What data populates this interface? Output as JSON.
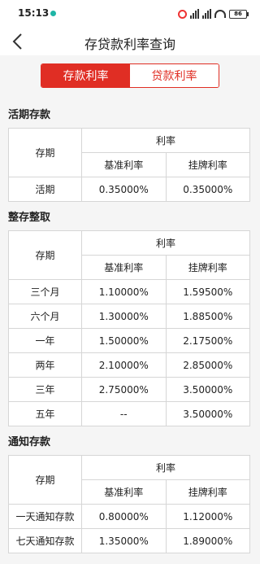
{
  "status_bar": {
    "time": "15:13",
    "battery": "86"
  },
  "header": {
    "title": "存贷款利率查询",
    "back_icon": "chevron-left-icon"
  },
  "tabs": [
    {
      "label": "存款利率",
      "active": true
    },
    {
      "label": "贷款利率",
      "active": false
    }
  ],
  "colors": {
    "accent": "#e02e24",
    "border": "#d6d6d6",
    "background": "#f5f5f5"
  },
  "sections": [
    {
      "title": "活期存款",
      "header": {
        "period": "存期",
        "rate": "利率",
        "base": "基准利率",
        "listed": "挂牌利率"
      },
      "rows": [
        {
          "period": "活期",
          "base": "0.35000%",
          "listed": "0.35000%"
        }
      ]
    },
    {
      "title": "整存整取",
      "header": {
        "period": "存期",
        "rate": "利率",
        "base": "基准利率",
        "listed": "挂牌利率"
      },
      "rows": [
        {
          "period": "三个月",
          "base": "1.10000%",
          "listed": "1.59500%"
        },
        {
          "period": "六个月",
          "base": "1.30000%",
          "listed": "1.88500%"
        },
        {
          "period": "一年",
          "base": "1.50000%",
          "listed": "2.17500%"
        },
        {
          "period": "两年",
          "base": "2.10000%",
          "listed": "2.85000%"
        },
        {
          "period": "三年",
          "base": "2.75000%",
          "listed": "3.50000%"
        },
        {
          "period": "五年",
          "base": "--",
          "listed": "3.50000%"
        }
      ]
    },
    {
      "title": "通知存款",
      "header": {
        "period": "存期",
        "rate": "利率",
        "base": "基准利率",
        "listed": "挂牌利率"
      },
      "rows": [
        {
          "period": "一天通知存款",
          "base": "0.80000%",
          "listed": "1.12000%"
        },
        {
          "period": "七天通知存款",
          "base": "1.35000%",
          "listed": "1.89000%"
        }
      ]
    }
  ]
}
